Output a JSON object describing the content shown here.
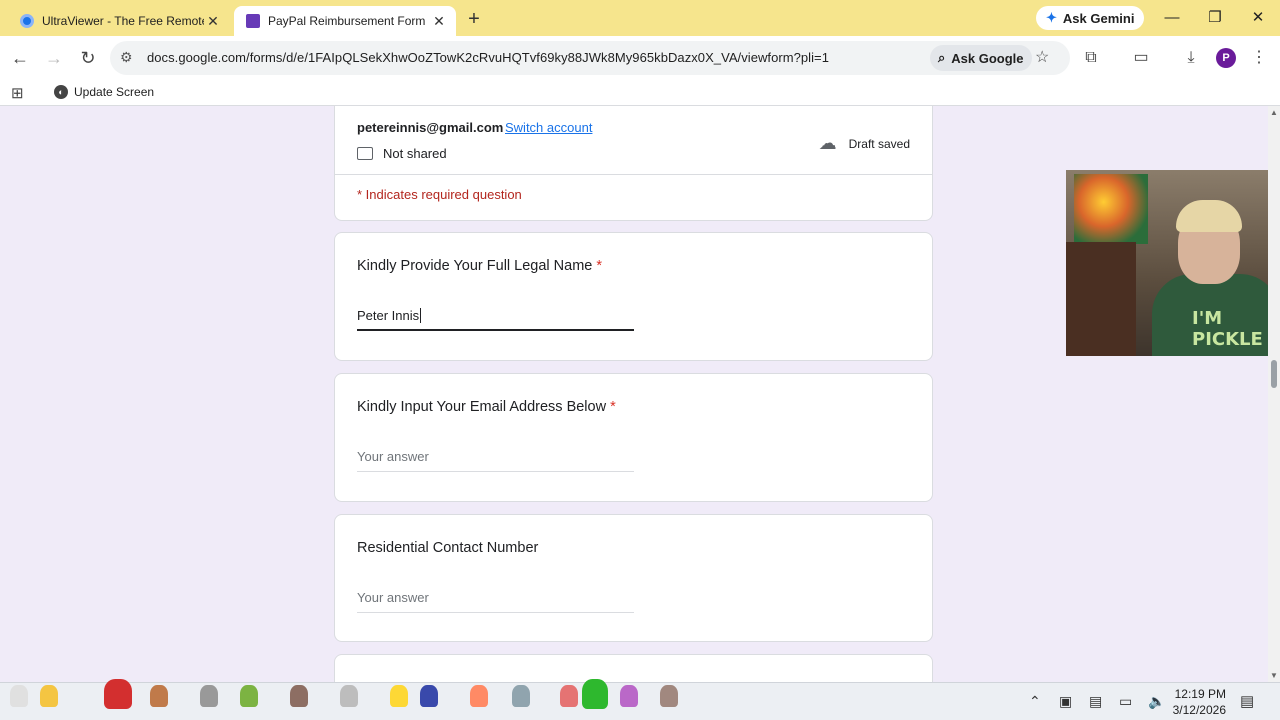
{
  "tabs": [
    {
      "title": "UltraViewer - The Free Remote",
      "close": "✕"
    },
    {
      "title": "PayPal Reimbursement Form",
      "close": "✕"
    }
  ],
  "new_tab": "+",
  "ask_gemini": "Ask Gemini",
  "window_controls": {
    "minimize": "—",
    "maximize": "❐",
    "close": "✕"
  },
  "nav": {
    "back": "←",
    "forward": "→",
    "reload": "↻"
  },
  "address": {
    "url": "docs.google.com/forms/d/e/1FAIpQLSekXhwOoZTowK2cRvuHQTvf69ky88JWk8My965kbDazx0X_VA/viewform?pli=1",
    "ask_google": "Ask Google"
  },
  "profile_initial": "P",
  "bookmarks": {
    "update_screen": "Update Screen"
  },
  "form": {
    "account_email": "petereinnis@gmail.com",
    "switch_account": "Switch account",
    "not_shared": "Not shared",
    "draft_status": "Draft saved",
    "required_note": "* Indicates required question",
    "questions": [
      {
        "title": "Kindly Provide Your Full Legal Name",
        "required_mark": " *",
        "value": "Peter Innis",
        "placeholder": "Your answer"
      },
      {
        "title": "Kindly Input Your Email Address Below",
        "required_mark": " *",
        "value": "",
        "placeholder": "Your answer"
      },
      {
        "title": "Residential Contact Number",
        "required_mark": "",
        "value": "",
        "placeholder": "Your answer"
      }
    ]
  },
  "webcam": {
    "shirt_text": "I'M PICKLE"
  },
  "taskbar": {
    "time": "12:19 PM",
    "date": "3/12/2026"
  },
  "colors": {
    "tab_strip": "#f6e58d",
    "form_bg": "#f0ebf8",
    "link": "#1a73e8",
    "required": "#d93025"
  }
}
